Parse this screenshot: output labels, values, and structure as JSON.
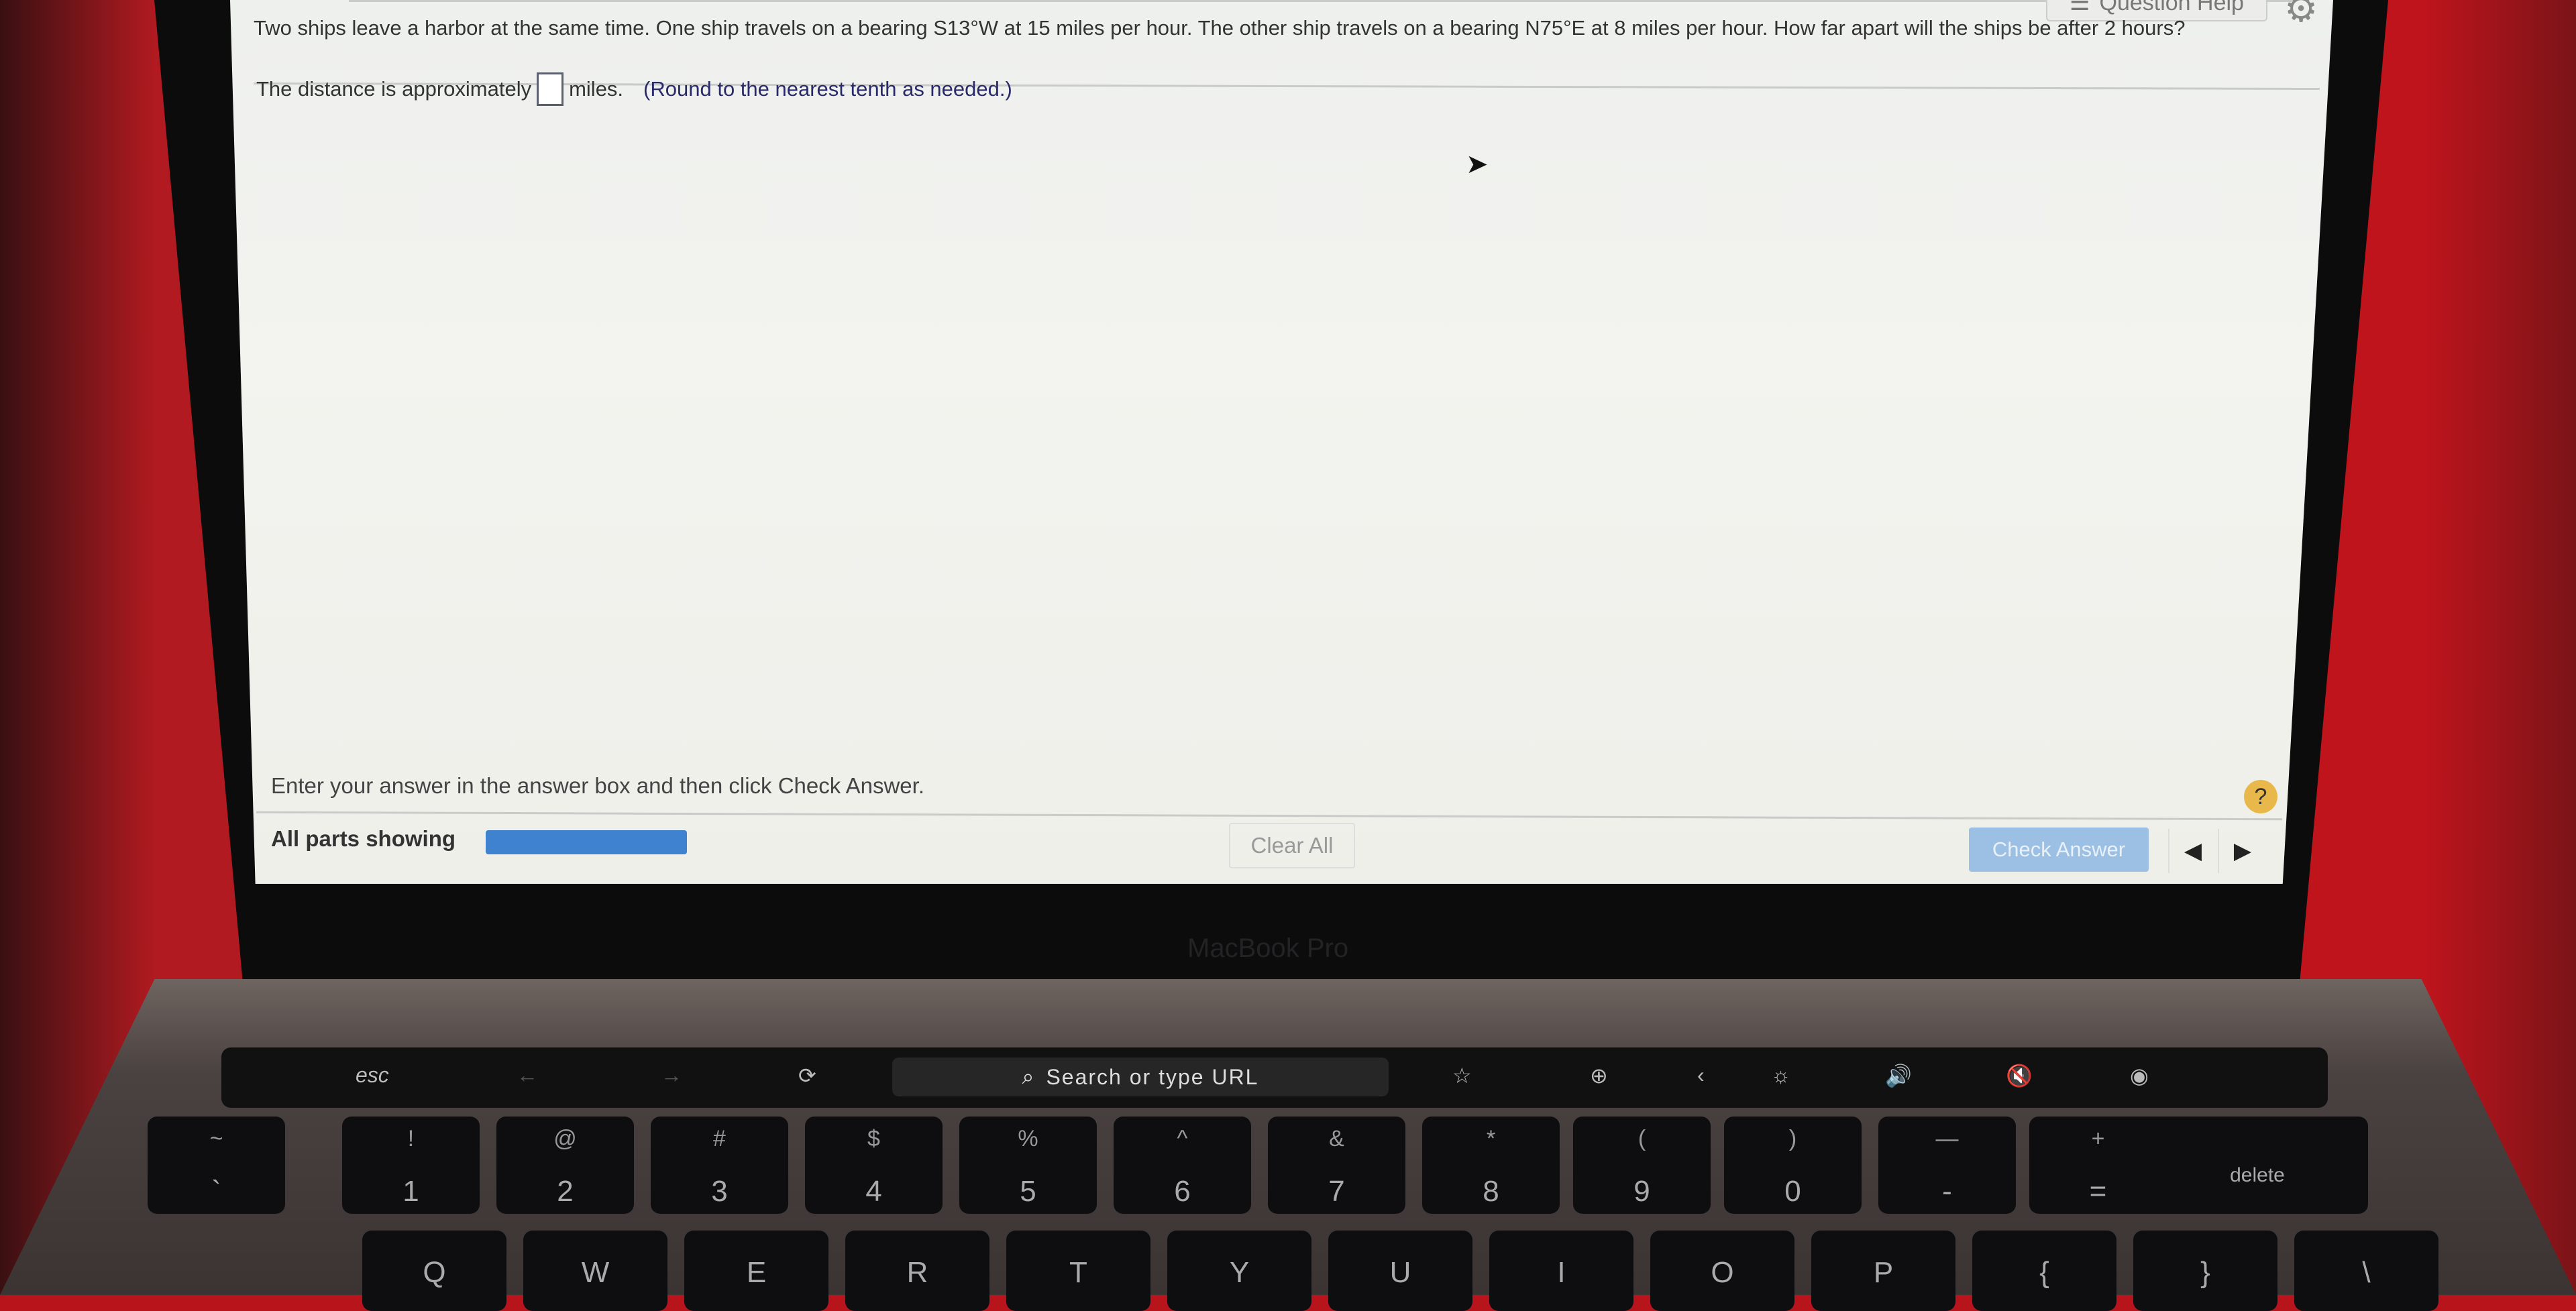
{
  "header": {
    "question_help": "Question Help",
    "question_help_icon": "list-icon",
    "settings_icon": "gear-icon"
  },
  "question": {
    "text": "Two ships leave a harbor at the same time. One ship travels on a bearing S13°W at 15 miles per hour. The other ship travels on a bearing N75°E at 8 miles per hour. How far apart will the ships be after 2 hours?"
  },
  "answer": {
    "prefix": "The distance is approximately",
    "value": "",
    "suffix": "miles.",
    "hint": "(Round to the nearest tenth as needed.)"
  },
  "footer": {
    "instruction": "Enter your answer in the answer box and then click Check Answer.",
    "help": "?",
    "parts_label": "All parts showing",
    "progress_percent": 100,
    "progress_color": "#3f82cf",
    "clear_all": "Clear All",
    "check_answer": "Check Answer",
    "prev": "◀",
    "next": "▶"
  },
  "laptop": {
    "brand": "MacBook Pro"
  },
  "touchbar": {
    "esc": "esc",
    "back": "←",
    "forward": "→",
    "reload": "⟳",
    "search_icon": "magnifier-icon",
    "search": "Search or type URL",
    "bookmark": "☆",
    "new_tab": "⊕",
    "collapse": "‹",
    "brightness": "☼",
    "volume": "🔊",
    "mute": "🔇",
    "siri": "◉"
  },
  "keys": {
    "number_row": [
      [
        "~",
        "`"
      ],
      [
        "!",
        "1"
      ],
      [
        "@",
        "2"
      ],
      [
        "#",
        "3"
      ],
      [
        "$",
        "4"
      ],
      [
        "%",
        "5"
      ],
      [
        "^",
        "6"
      ],
      [
        "&",
        "7"
      ],
      [
        "*",
        "8"
      ],
      [
        "(",
        "9"
      ],
      [
        ")",
        "0"
      ],
      [
        "—",
        "-"
      ],
      [
        "+",
        "="
      ],
      [
        "",
        "delete"
      ]
    ],
    "letter_row": [
      "Q",
      "W",
      "E",
      "R",
      "T",
      "Y",
      "U",
      "I",
      "O",
      "P",
      "{",
      "}",
      "\\"
    ]
  }
}
